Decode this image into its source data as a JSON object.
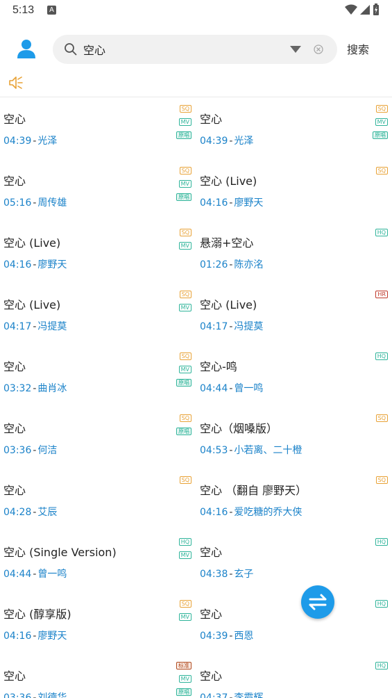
{
  "status_bar": {
    "time": "5:13",
    "a_icon": "A"
  },
  "search": {
    "value": "空心",
    "placeholder": "",
    "button_label": "搜索"
  },
  "colors": {
    "accent": "#1e9be9",
    "link": "#1a82c9",
    "sq": "#e8a236",
    "mv": "#2fb49a",
    "hr": "#c0392b"
  },
  "results": [
    {
      "title": "空心",
      "duration": "04:39",
      "artist": "光泽",
      "badges": [
        {
          "type": "sq",
          "label": "SQ"
        },
        {
          "type": "mv",
          "label": "MV"
        },
        {
          "type": "yc",
          "label": "原唱"
        }
      ]
    },
    {
      "title": "空心",
      "duration": "04:39",
      "artist": "光泽",
      "badges": [
        {
          "type": "sq",
          "label": "SQ"
        },
        {
          "type": "mv",
          "label": "MV"
        },
        {
          "type": "yc",
          "label": "原唱"
        }
      ]
    },
    {
      "title": "空心",
      "duration": "05:16",
      "artist": "周传雄",
      "badges": [
        {
          "type": "sq",
          "label": "SQ"
        },
        {
          "type": "mv",
          "label": "MV"
        },
        {
          "type": "yc",
          "label": "原唱"
        }
      ]
    },
    {
      "title": "空心 (Live)",
      "duration": "04:16",
      "artist": "廖野天",
      "badges": [
        {
          "type": "sq",
          "label": "SQ"
        }
      ]
    },
    {
      "title": "空心 (Live)",
      "duration": "04:16",
      "artist": "廖野天",
      "badges": [
        {
          "type": "sq",
          "label": "SQ"
        },
        {
          "type": "mv",
          "label": "MV"
        }
      ]
    },
    {
      "title": "悬溺+空心",
      "duration": "01:26",
      "artist": "陈亦洺",
      "badges": [
        {
          "type": "hq",
          "label": "HQ"
        }
      ]
    },
    {
      "title": "空心 (Live)",
      "duration": "04:17",
      "artist": "冯提莫",
      "badges": [
        {
          "type": "sq",
          "label": "SQ"
        },
        {
          "type": "mv",
          "label": "MV"
        }
      ]
    },
    {
      "title": "空心 (Live)",
      "duration": "04:17",
      "artist": "冯提莫",
      "badges": [
        {
          "type": "hr",
          "label": "HR"
        }
      ]
    },
    {
      "title": "空心",
      "duration": "03:32",
      "artist": "曲肖冰",
      "badges": [
        {
          "type": "sq",
          "label": "SQ"
        },
        {
          "type": "mv",
          "label": "MV"
        },
        {
          "type": "yc",
          "label": "原唱"
        }
      ]
    },
    {
      "title": "空心-鸣",
      "duration": "04:44",
      "artist": "曾一鸣",
      "badges": [
        {
          "type": "hq",
          "label": "HQ"
        }
      ]
    },
    {
      "title": "空心",
      "duration": "03:36",
      "artist": "何洁",
      "badges": [
        {
          "type": "sq",
          "label": "SQ"
        },
        {
          "type": "yc",
          "label": "原唱"
        }
      ]
    },
    {
      "title": "空心（烟嗓版）",
      "duration": "04:53",
      "artist": "小若离、二十橙",
      "badges": [
        {
          "type": "sq",
          "label": "SQ"
        }
      ]
    },
    {
      "title": "空心",
      "duration": "04:28",
      "artist": "艾辰",
      "badges": [
        {
          "type": "sq",
          "label": "SQ"
        }
      ]
    },
    {
      "title": "空心 （翻自 廖野天）",
      "duration": "04:16",
      "artist": "爱吃糖的乔大侠",
      "badges": [
        {
          "type": "sq",
          "label": "SQ"
        }
      ]
    },
    {
      "title": "空心 (Single Version)",
      "duration": "04:44",
      "artist": "曾一鸣",
      "badges": [
        {
          "type": "hq",
          "label": "HQ"
        },
        {
          "type": "mv",
          "label": "MV"
        }
      ]
    },
    {
      "title": "空心",
      "duration": "04:38",
      "artist": "玄子",
      "badges": [
        {
          "type": "hq",
          "label": "HQ"
        }
      ]
    },
    {
      "title": "空心 (醇享版)",
      "duration": "04:16",
      "artist": "廖野天",
      "badges": [
        {
          "type": "sq",
          "label": "SQ"
        },
        {
          "type": "mv",
          "label": "MV"
        }
      ]
    },
    {
      "title": "空心",
      "duration": "04:39",
      "artist": "西恩",
      "badges": [
        {
          "type": "hq",
          "label": "HQ"
        }
      ]
    },
    {
      "title": "空心",
      "duration": "03:36",
      "artist": "刘德华",
      "badges": [
        {
          "type": "bz",
          "label": "标准"
        },
        {
          "type": "mv",
          "label": "MV"
        },
        {
          "type": "yc",
          "label": "原唱"
        }
      ]
    },
    {
      "title": "空心",
      "duration": "04:37",
      "artist": "李霞辉",
      "badges": [
        {
          "type": "hq",
          "label": "HQ"
        }
      ]
    }
  ],
  "icons": {
    "avatar": "person-icon",
    "search": "search-icon",
    "dropdown": "triangle-down-icon",
    "clear": "clear-icon",
    "speaker": "speaker-icon",
    "fab": "swap-arrows-icon"
  }
}
